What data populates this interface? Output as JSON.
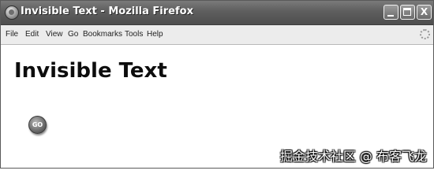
{
  "window": {
    "title": "Invisible Text - Mozilla Firefox",
    "controls": {
      "minimize": "",
      "maximize": "",
      "close": "X"
    }
  },
  "menubar": {
    "items": [
      "File",
      "Edit",
      "View",
      "Go",
      "Bookmarks",
      "Tools",
      "Help"
    ]
  },
  "page": {
    "heading": "Invisible Text",
    "go_button_label": "GO"
  },
  "watermark": "掘金技术社区 @ 布客飞龙",
  "icons": {
    "app": "firefox-icon",
    "throbber": "throbber-icon"
  }
}
